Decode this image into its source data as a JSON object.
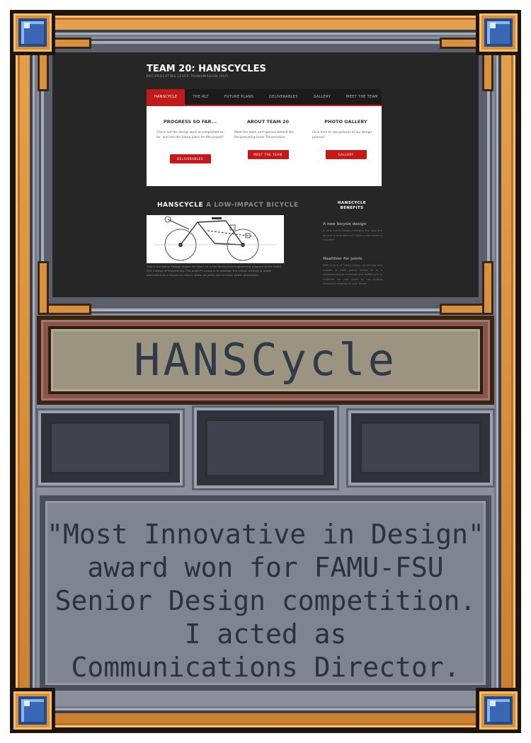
{
  "card": {
    "title": "HANSCycle",
    "description": "\"Most Innovative in Design\"\naward won for FAMU-FSU\nSenior Design competition.\nI acted as\nCommunications Director.",
    "gem_icon": "blue-gem-icon",
    "colors": {
      "gold": "#d8913f",
      "panel": "#8a8f9c",
      "gem": "#3a67b3",
      "plate": "#9c9480",
      "text": "#2f3a4a"
    }
  },
  "website": {
    "title": "TEAM 20: HANSCYCLES",
    "subtitle": "RECIPROCATING LEVER TRANSMISSION (RLT)",
    "nav": [
      "HANSCYCLE",
      "THE RLT",
      "FUTURE PLANS",
      "DELIVERABLES",
      "GALLERY",
      "MEET THE TEAM"
    ],
    "columns": [
      {
        "heading": "PROGRESS SO FAR...",
        "text": "Check out the design work accomplished so far, and see the future plans for the project!",
        "button": "DELIVERABLES"
      },
      {
        "heading": "ABOUT TEAM 20",
        "text": "Meet the team and sponsor behind the Reciprocating Lever Transmission",
        "button": "MEET THE TEAM"
      },
      {
        "heading": "PHOTO GALLERY",
        "text": "Click here to see pictures of our design process!",
        "button": "GALLERY"
      }
    ],
    "section": {
      "heading_bold": "HANSCYCLE",
      "heading_rest": "A LOW-IMPACT BICYCLE",
      "body": "This is the Senior Design project for Team 20 in the Mechanical Engineering program at the FAMU-FSU College of Engineering. The project's scope is to redesign the classic method of power generation on a bicycle to reduce stress on joints and increase power generation."
    },
    "benefits": {
      "title": "HANSCYCLE BENEFITS",
      "items": [
        {
          "heading": "A new bicycle design",
          "text": "A new crank design changes the way the bicycle is oriented such that a new frame is required."
        },
        {
          "heading": "Healthier for joints",
          "text": "With a lack of \"dead zones\" at the top and bottom of each power stroke as in a classical bicycle crankset, the HANSCycle is healthier for your joints by not adding abnormal stresses to your knees."
        }
      ]
    }
  }
}
